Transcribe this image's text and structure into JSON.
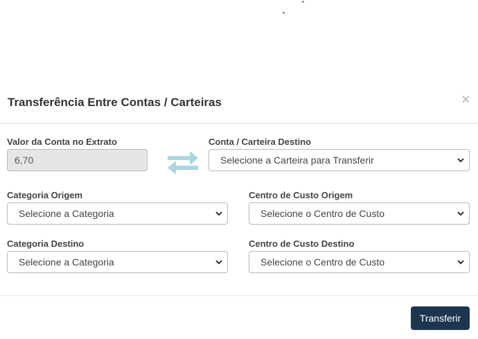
{
  "modal": {
    "title": "Transferência Entre Contas / Carteiras",
    "close_glyph": "×",
    "icons": [
      "close-icon",
      "swap-arrows-icon",
      "chevron-down-icon"
    ],
    "accent_color": "#a9d6e2",
    "button_color": "#1c3550"
  },
  "form": {
    "valor_label": "Valor da Conta no Extrato",
    "valor_value": "6,70",
    "conta_destino_label": "Conta / Carteira Destino",
    "conta_destino_selected": "Selecione a Carteira para Transferir",
    "categoria_origem_label": "Categoria Origem",
    "categoria_origem_selected": "Selecione a Categoria",
    "centro_origem_label": "Centro de Custo Origem",
    "centro_origem_selected": "Selecione o Centro de Custo",
    "categoria_destino_label": "Categoria Destino",
    "categoria_destino_selected": "Selecione a Categoria",
    "centro_destino_label": "Centro de Custo Destino",
    "centro_destino_selected": "Selecione o Centro de Custo"
  },
  "footer": {
    "submit_label": "Transferir"
  }
}
